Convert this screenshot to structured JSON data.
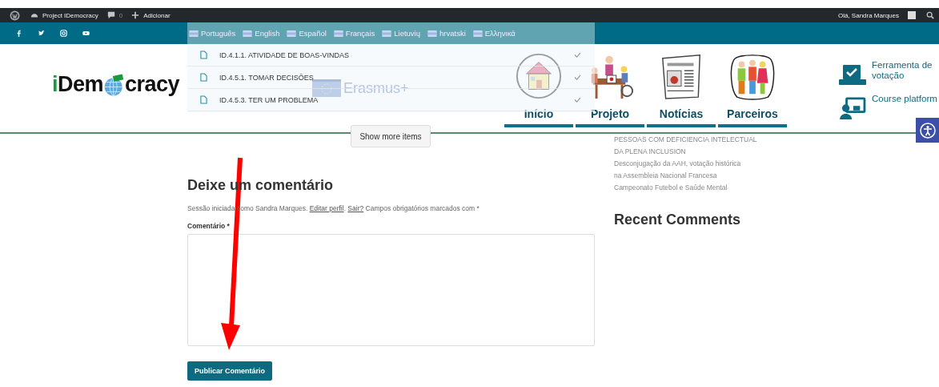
{
  "admin_bar": {
    "site": "Project IDemocracy",
    "comments": "0",
    "add": "Adicionar",
    "greeting": "Olá, Sandra Marques"
  },
  "languages": [
    {
      "label": "Português"
    },
    {
      "label": "English"
    },
    {
      "label": "Español"
    },
    {
      "label": "Français"
    },
    {
      "label": "Lietuvių"
    },
    {
      "label": "hrvatski"
    },
    {
      "label": "Ελληνικά"
    }
  ],
  "dropdown_items": [
    {
      "label": "ID.4.1.1. ATIVIDADE DE BOAS-VINDAS",
      "checked": true
    },
    {
      "label": "ID.4.5.1. TOMAR DECISÕES",
      "checked": true
    },
    {
      "label": "ID.4.5.3. TER UM PROBLEMA",
      "checked": true
    }
  ],
  "logo": {
    "text_start": "iDem",
    "text_end": "cracy"
  },
  "erasmus": "Erasmus+",
  "nav": [
    {
      "label": "Início",
      "kind": "house"
    },
    {
      "label": "Projeto",
      "kind": "meeting"
    },
    {
      "label": "Notícias",
      "kind": "newspaper"
    },
    {
      "label": "Parceiros",
      "kind": "people"
    }
  ],
  "tools": [
    {
      "kind": "vote",
      "label": "Ferramenta de votação"
    },
    {
      "kind": "course",
      "label": "Course platform"
    }
  ],
  "show_more": "Show more items",
  "comment_form": {
    "heading": "Deixe um comentário",
    "logged_in": "Sessão iniciada como Sandra Marques.",
    "edit_link": "Editar perfil",
    "separator": ".",
    "logout_link": "Sair?",
    "required_note": "Campos obrigatórios marcados com *",
    "field_label": "Comentário *",
    "submit": "Publicar Comentário"
  },
  "sidebar": {
    "links": [
      "PESSOAS COM DEFICIENCIA INTELECTUAL",
      "DA PLENA INCLUSION",
      "Desconjugação da AAH, votação histórica",
      "na Assembleia Nacional Francesa",
      "Campeonato Futebol e Saúde Mental"
    ],
    "recent_comments": "Recent Comments"
  }
}
